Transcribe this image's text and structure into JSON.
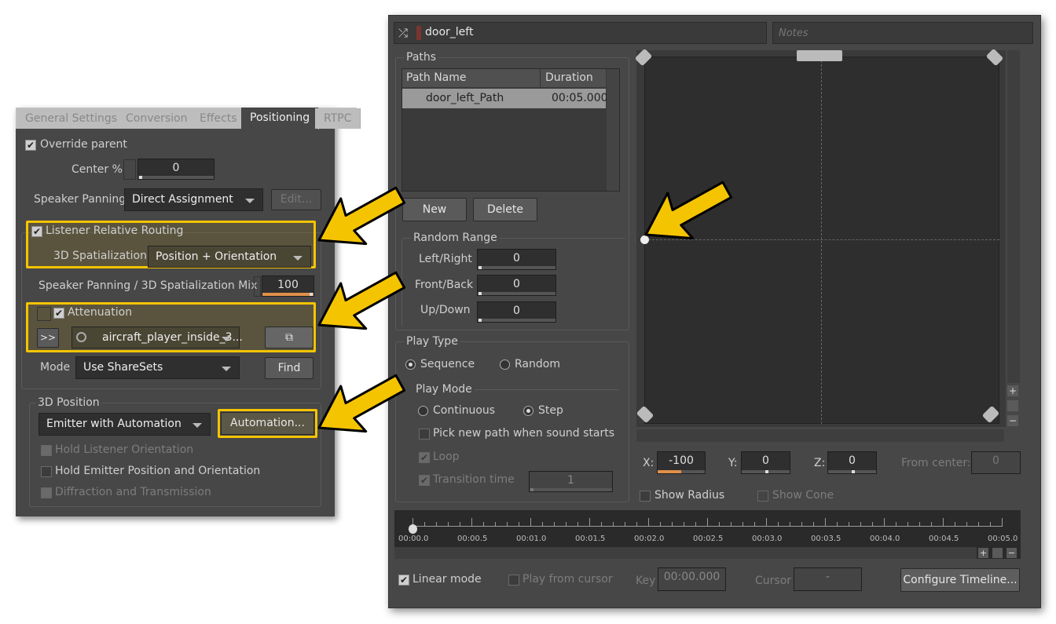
{
  "left_panel": {
    "tabs": [
      "General Settings",
      "Conversion",
      "Effects",
      "Positioning",
      "RTPC"
    ],
    "active_tab": "Positioning",
    "override_parent": "Override parent",
    "center_label": "Center %",
    "center_value": "0",
    "speaker_panning_label": "Speaker Panning",
    "speaker_panning_value": "Direct Assignment",
    "edit_button": "Edit...",
    "listener_relative_routing": "Listener Relative Routing",
    "spatialization_label": "3D Spatialization",
    "spatialization_value": "Position + Orientation",
    "mix_label": "Speaker Panning / 3D Spatialization Mix",
    "mix_value": "100",
    "mix_percent": 100,
    "attenuation": "Attenuation",
    "expand_button": ">>",
    "attenuation_value": "aircraft_player_inside_3...",
    "mode_label": "Mode",
    "mode_value": "Use ShareSets",
    "find_button": "Find",
    "position_group": "3D Position",
    "position_value": "Emitter with Automation",
    "automation_button": "Automation...",
    "hold_listener": "Hold Listener Orientation",
    "hold_emitter": "Hold Emitter Position and Orientation",
    "diffraction": "Diffraction and Transmission"
  },
  "right_panel": {
    "object_name": "door_left",
    "notes_placeholder": "Notes",
    "paths_group": "Paths",
    "columns": [
      "Path Name",
      "Duration"
    ],
    "rows": [
      {
        "name": "door_left_Path",
        "duration": "00:05.000"
      }
    ],
    "new_button": "New",
    "delete_button": "Delete",
    "random_range": "Random Range",
    "left_right_label": "Left/Right",
    "left_right": "0",
    "front_back_label": "Front/Back",
    "front_back": "0",
    "up_down_label": "Up/Down",
    "up_down": "0",
    "play_type": "Play Type",
    "sequence": "Sequence",
    "random": "Random",
    "play_mode": "Play Mode",
    "continuous": "Continuous",
    "step": "Step",
    "pick_new_path": "Pick new path when sound starts",
    "loop": "Loop",
    "transition_time": "Transition time",
    "transition_value": "1",
    "x_label": "X:",
    "x_value": "-100",
    "y_label": "Y:",
    "y_value": "0",
    "z_label": "Z:",
    "z_value": "0",
    "from_center_label": "From center:",
    "from_center_value": "0",
    "show_radius": "Show Radius",
    "show_cone": "Show Cone",
    "timeline_ticks": [
      "00:00.0",
      "00:00.5",
      "00:01.0",
      "00:01.5",
      "00:02.0",
      "00:02.5",
      "00:03.0",
      "00:03.5",
      "00:04.0",
      "00:04.5",
      "00:05.0"
    ],
    "linear_mode": "Linear mode",
    "play_from_cursor": "Play from cursor",
    "key_label": "Key",
    "key_value": "00:00.000",
    "cursor_label": "Cursor",
    "cursor_value": "-",
    "configure_timeline": "Configure Timeline..."
  },
  "colors": {
    "highlight": "#f5c400",
    "accent_bar": "#e0904a"
  }
}
